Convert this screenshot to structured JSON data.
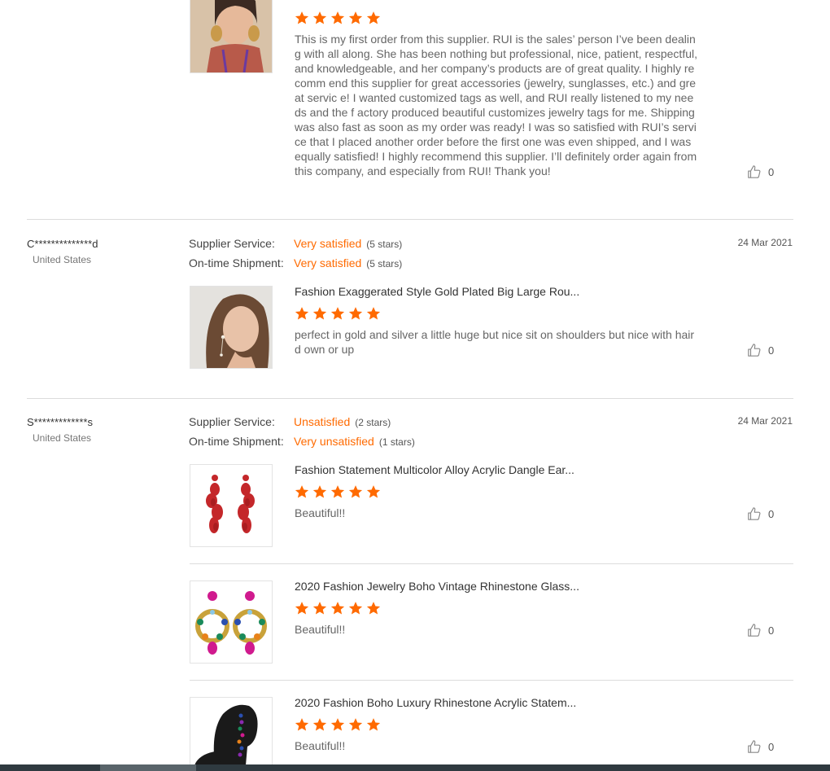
{
  "colors": {
    "accent": "#ff6a00",
    "divider": "#dcdcdc",
    "bar": "#2f3a40"
  },
  "first_item": {
    "review_text": "This is my first order from this supplier. RUI is the sales’ person I’ve been dealing with all along. She has been nothing but professional, nice, patient, respectful, and knowledgeable, and her company’s products are of great quality. I highly recomm end this supplier for great accessories (jewelry, sunglasses, etc.) and great servic e! I wanted customized tags as well, and RUI really listened to my needs and the f actory produced beautiful customizes jewelry tags for me. Shipping was also fast as soon as my order was ready! I was so satisfied with RUI’s service that I placed another order before the first one was even shipped, and I was equally satisfied! I highly recommend this supplier. I’ll definitely order again from this company, and especially from RUI! Thank you!",
    "rating": 5,
    "likes": "0"
  },
  "reviews": [
    {
      "user": "C**************d",
      "country": "United States",
      "date": "24 Mar 2021",
      "supplier_service_label": "Supplier Service:",
      "supplier_service_value": "Very satisfied",
      "supplier_service_stars": "(5 stars)",
      "shipment_label": "On-time Shipment:",
      "shipment_value": "Very satisfied",
      "shipment_stars": "(5 stars)",
      "items": [
        {
          "title": "Fashion Exaggerated Style Gold Plated Big Large Rou...",
          "rating": 5,
          "text": "perfect in gold and silver a little huge but nice sit on shoulders but nice with hair d own or up",
          "likes": "0",
          "image": "earring-model-photo"
        }
      ]
    },
    {
      "user": "S*************s",
      "country": "United States",
      "date": "24 Mar 2021",
      "supplier_service_label": "Supplier Service:",
      "supplier_service_value": "Unsatisfied",
      "supplier_service_stars": "(2 stars)",
      "shipment_label": "On-time Shipment:",
      "shipment_value": "Very unsatisfied",
      "shipment_stars": "(1 stars)",
      "items": [
        {
          "title": "Fashion Statement Multicolor Alloy Acrylic Dangle Ear...",
          "rating": 5,
          "text": "Beautiful!!",
          "likes": "0",
          "image": "red-petal-earrings-photo"
        },
        {
          "title": "2020 Fashion Jewelry Boho Vintage Rhinestone Glass...",
          "rating": 5,
          "text": "Beautiful!!",
          "likes": "0",
          "image": "rhinestone-earrings-photo"
        },
        {
          "title": "2020 Fashion Boho Luxury Rhinestone Acrylic Statem...",
          "rating": 5,
          "text": "Beautiful!!",
          "likes": "0",
          "image": "mannequin-earring-photo"
        }
      ]
    }
  ],
  "icons": {
    "star": "star-icon",
    "like": "thumbs-up-icon"
  }
}
